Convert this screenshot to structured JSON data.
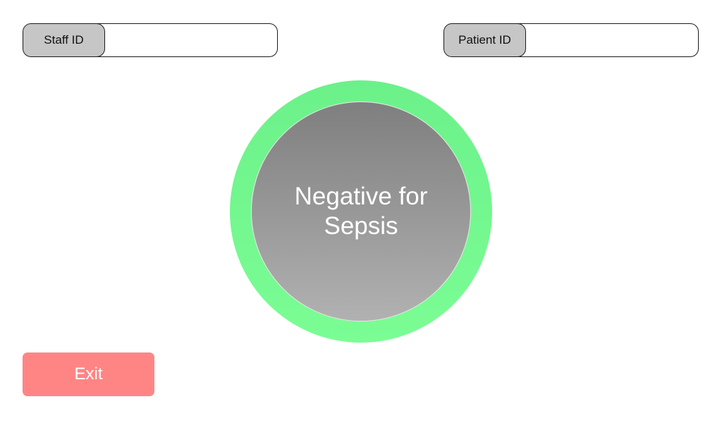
{
  "staff_field": {
    "label": "Staff ID",
    "value": ""
  },
  "patient_field": {
    "label": "Patient ID",
    "value": ""
  },
  "result": {
    "line1": "Negative for",
    "line2": "Sepsis",
    "ring_color": "#72f48e",
    "core_color": "#8f8f8f"
  },
  "exit_button": {
    "label": "Exit",
    "color": "#ff8585"
  }
}
